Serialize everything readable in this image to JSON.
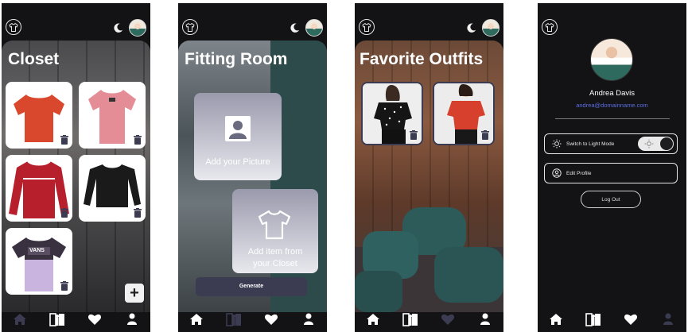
{
  "screens": {
    "closet": {
      "title": "Closet",
      "add_label": "+",
      "items": [
        {
          "name": "orange t-shirt",
          "color": "#d9482c"
        },
        {
          "name": "pink t-shirt",
          "color": "#e58d96"
        },
        {
          "name": "red long sleeve",
          "color": "#b81f2d"
        },
        {
          "name": "black long sleeve",
          "color": "#1a1a1a"
        },
        {
          "name": "vans t-shirt",
          "color": "#c9b4e0",
          "print": "VANS"
        }
      ]
    },
    "fitting_room": {
      "title": "Fitting Room",
      "add_picture_label": "Add your Picture",
      "add_item_label_line1": "Add item from",
      "add_item_label_line2": "your Closet",
      "generate_label": "Generate"
    },
    "favorites": {
      "title": "Favorite Outfits"
    },
    "profile": {
      "name": "Andrea Davis",
      "email": "andrea@domainname.com",
      "switch_label": "Switch to Light Mode",
      "edit_label": "Edit Profile",
      "logout_label": "Log Out"
    }
  },
  "nav": {
    "items": [
      "home-icon",
      "fitting-room-icon",
      "heart-icon",
      "user-icon"
    ],
    "active_color": "#3b3b52",
    "inactive_color": "#ffffff"
  },
  "colors": {
    "phone_bg": "#131316",
    "accent": "#3b3b52",
    "link": "#5b6ee0"
  }
}
